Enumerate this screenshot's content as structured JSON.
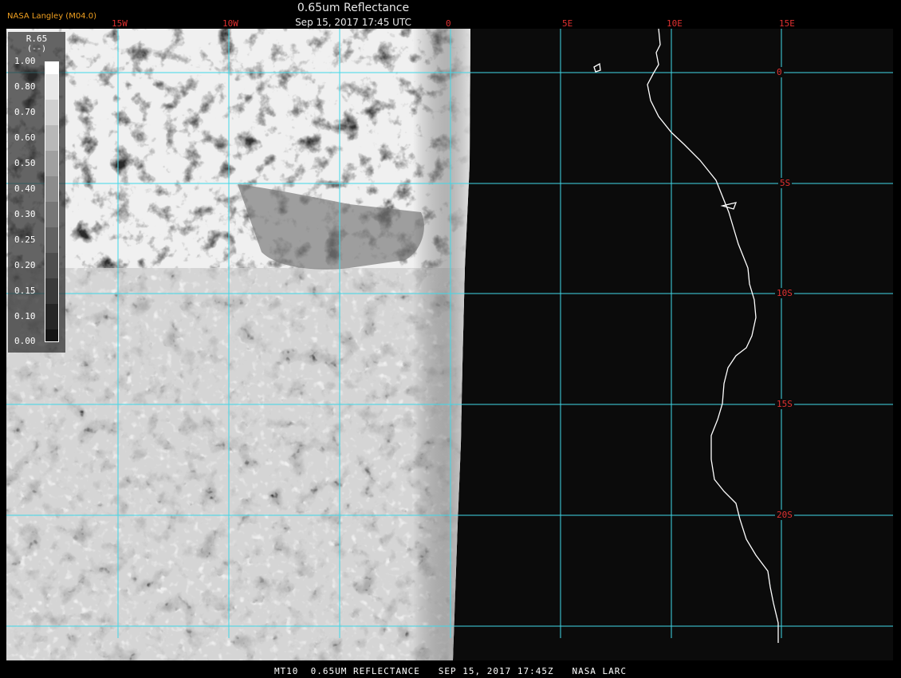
{
  "header": {
    "credit": "NASA Langley (M04.0)",
    "title": "0.65um Reflectance",
    "datetime": "Sep 15, 2017 17:45 UTC"
  },
  "legend": {
    "title": "R.65",
    "units": "(--)",
    "ticks": [
      "1.00",
      "0.80",
      "0.70",
      "0.60",
      "0.50",
      "0.40",
      "0.30",
      "0.25",
      "0.20",
      "0.15",
      "0.10",
      "0.00"
    ]
  },
  "grid": {
    "longitudes": [
      "15W",
      "10W",
      "0",
      "5E",
      "10E",
      "15E"
    ],
    "latitudes": [
      "0",
      "5S",
      "10S",
      "15S",
      "20S"
    ],
    "color": "#40d8e8"
  },
  "footer": {
    "text": "MT10  0.65UM REFLECTANCE   SEP 15, 2017 17:45Z   NASA LARC"
  },
  "colors": {
    "label": "#e03030",
    "credit": "#f0a020",
    "coastline": "#ffffff"
  }
}
